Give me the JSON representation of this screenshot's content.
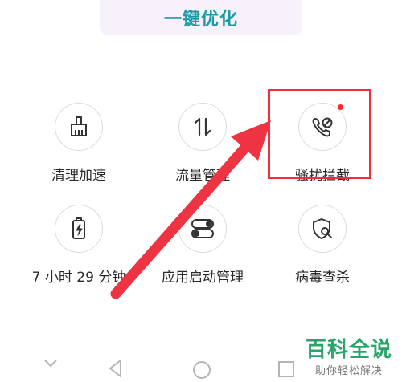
{
  "optimize": {
    "label": "一键优化"
  },
  "tiles": [
    {
      "label": "清理加速",
      "icon": "broom-icon"
    },
    {
      "label": "流量管理",
      "icon": "data-transfer-icon"
    },
    {
      "label": "骚扰拦截",
      "icon": "blocked-call-icon",
      "has_badge": true
    },
    {
      "label": "7 小时 29 分钟",
      "icon": "battery-icon"
    },
    {
      "label": "应用启动管理",
      "icon": "app-toggle-icon"
    },
    {
      "label": "病毒查杀",
      "icon": "virus-shield-icon"
    }
  ],
  "navbar": {
    "items": [
      "back-icon",
      "home-icon",
      "recents-icon"
    ]
  },
  "watermark": {
    "title": "百科全说",
    "subtitle": "助你轻松解决"
  },
  "colors": {
    "accent": "#1d9ba6",
    "highlight": "#ee2e3b",
    "badge": "#ff2a2a",
    "watermark": "#2aa46a"
  }
}
